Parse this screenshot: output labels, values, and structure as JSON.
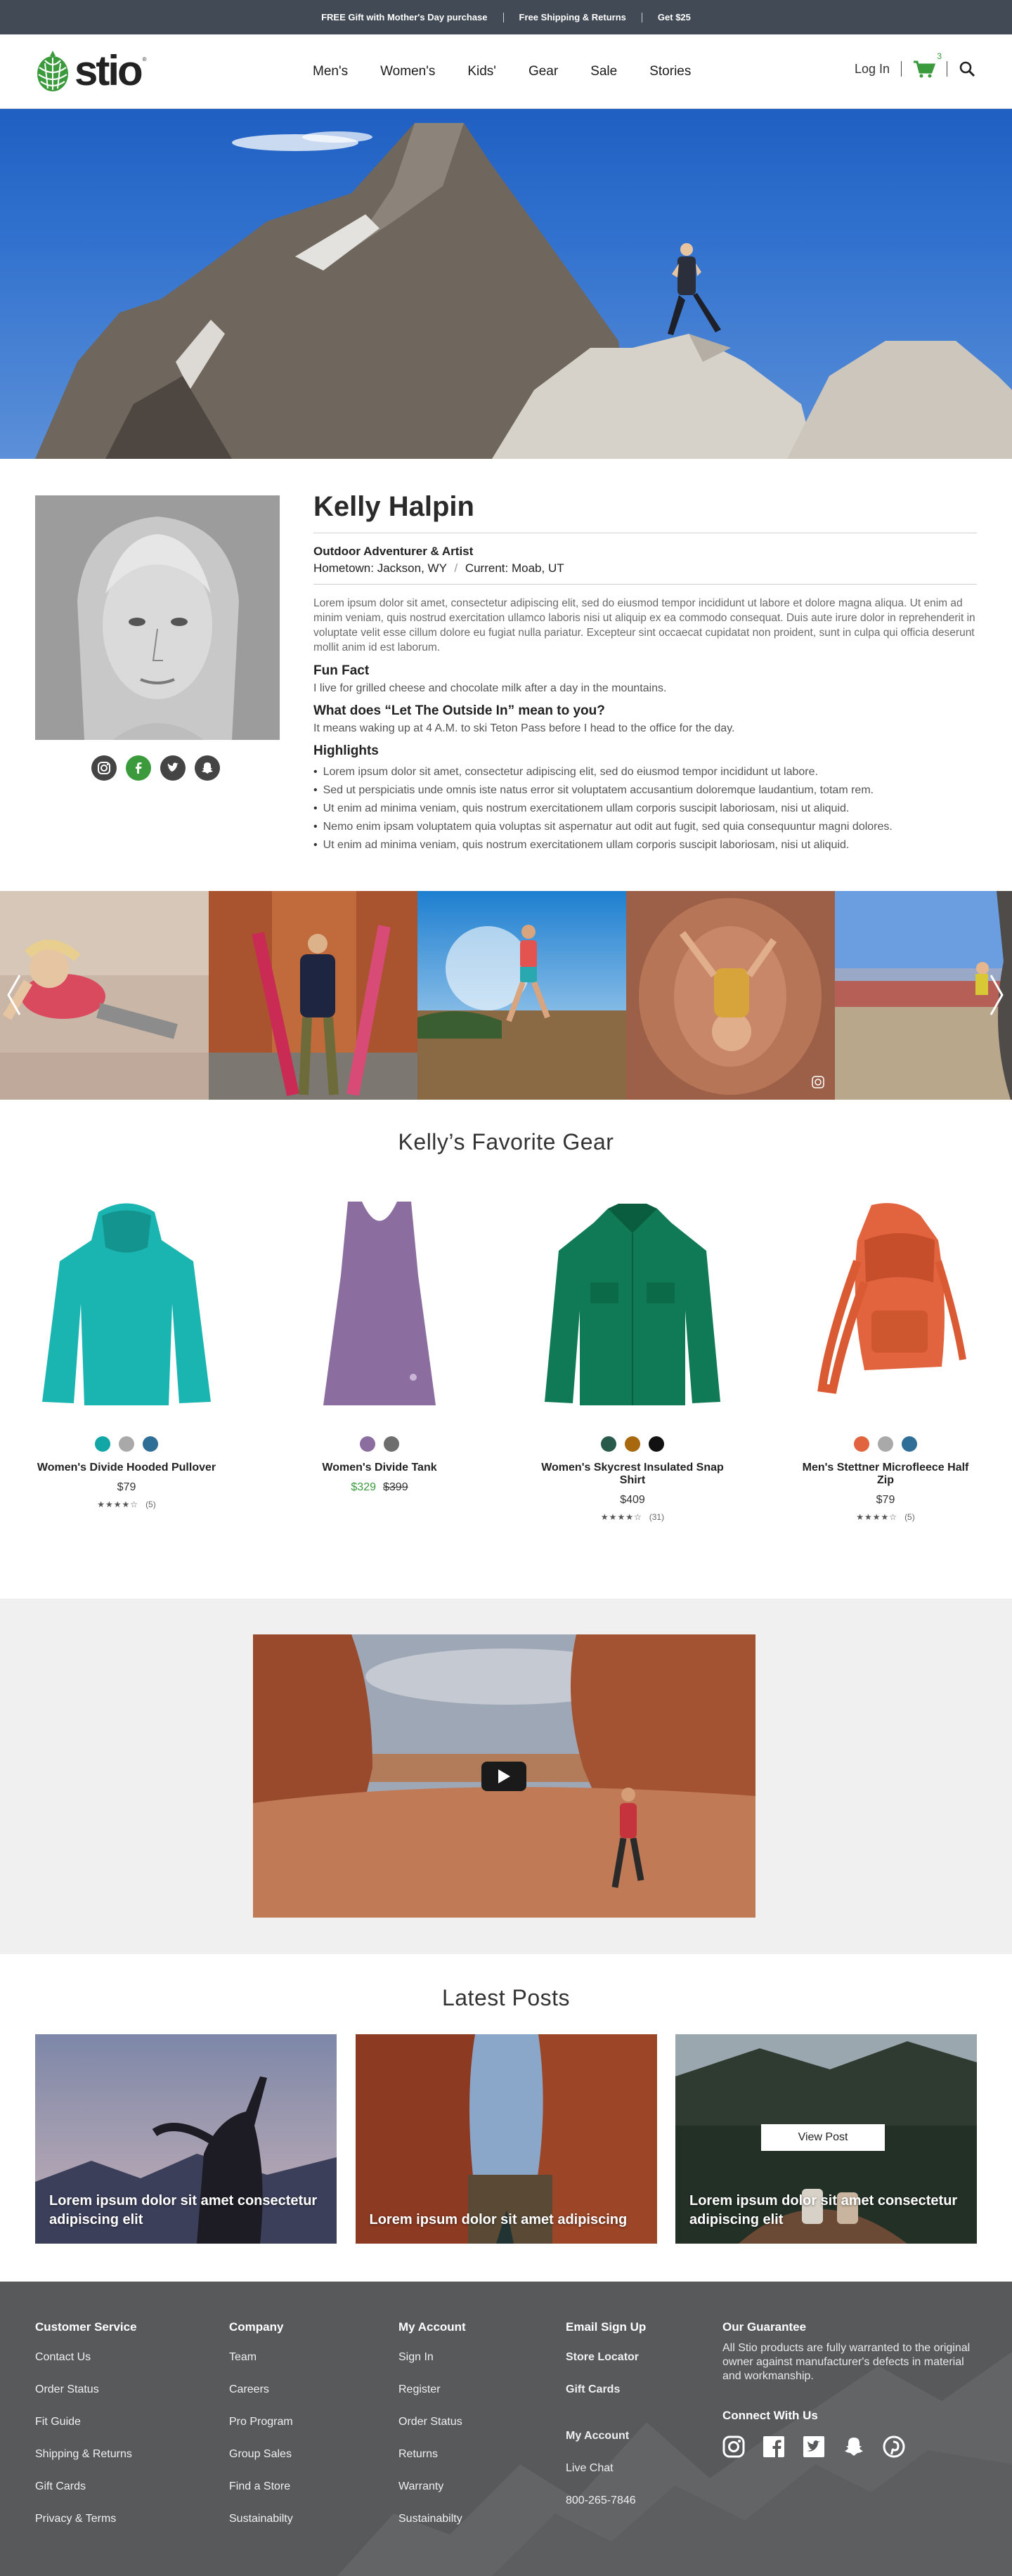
{
  "promo": {
    "items": [
      "FREE Gift with Mother's Day purchase",
      "Free Shipping & Returns",
      "Get $25"
    ]
  },
  "header": {
    "logo_text": "stio",
    "logo_tm": "®",
    "nav": [
      "Men's",
      "Women's",
      "Kids'",
      "Gear",
      "Sale",
      "Stories"
    ],
    "login": "Log In",
    "cart_count": "3",
    "icons": [
      "cart-icon",
      "search-icon"
    ]
  },
  "profile": {
    "name": "Kelly Halpin",
    "role": "Outdoor Adventurer & Artist",
    "hometown_label": "Hometown:",
    "hometown": "Jackson, WY",
    "current_label": "Current:",
    "current": "Moab, UT",
    "bio": "Lorem ipsum dolor sit amet, consectetur adipiscing elit, sed do eiusmod tempor incididunt ut labore et dolore magna aliqua. Ut enim ad minim veniam, quis nostrud exercitation ullamco laboris nisi ut aliquip ex ea commodo consequat. Duis aute irure dolor in reprehenderit in voluptate velit esse cillum dolore eu fugiat nulla pariatur. Excepteur sint occaecat cupidatat non proident, sunt in culpa qui officia deserunt mollit anim id est laborum.",
    "fun_fact_title": "Fun Fact",
    "fun_fact": "I live for grilled cheese and chocolate milk after a day in the mountains.",
    "outside_title": "What does “Let The Outside In” mean to you?",
    "outside_answer": "It means waking up at 4 A.M. to ski Teton Pass before I head to the office for the day.",
    "highlights_title": "Highlights",
    "highlights": [
      "Lorem ipsum dolor sit amet, consectetur adipiscing elit, sed do eiusmod tempor incididunt ut labore.",
      "Sed ut perspiciatis unde omnis iste natus error sit voluptatem accusantium doloremque laudantium, totam rem.",
      "Ut enim ad minima veniam, quis nostrum exercitationem ullam corporis suscipit laboriosam, nisi ut aliquid.",
      "Nemo enim ipsam voluptatem quia voluptas sit aspernatur aut odit aut fugit, sed quia consequuntur magni dolores.",
      "Ut enim ad minima veniam, quis nostrum exercitationem ullam corporis suscipit laboriosam, nisi ut aliquid."
    ],
    "social_icons": [
      "instagram-icon",
      "facebook-icon",
      "twitter-icon",
      "snapchat-icon"
    ]
  },
  "gear": {
    "title": "Kelly’s Favorite Gear",
    "products": [
      {
        "name": "Women's Divide Hooded Pullover",
        "price": "$79",
        "sale_price": "",
        "was_price": "",
        "rating": 4,
        "reviews": "(5)",
        "swatches": [
          "#12a6a6",
          "#a9a9a9",
          "#2f6f97"
        ]
      },
      {
        "name": "Women's Divide Tank",
        "price": "",
        "sale_price": "$329",
        "was_price": "$399",
        "rating": 4,
        "reviews": "",
        "swatches": [
          "#8b6d9f",
          "#6e6e6e"
        ]
      },
      {
        "name": "Women's Skycrest Insulated Snap Shirt",
        "price": "$409",
        "sale_price": "",
        "was_price": "",
        "rating": 4,
        "reviews": "(31)",
        "swatches": [
          "#285a4b",
          "#a8680d",
          "#111111"
        ]
      },
      {
        "name": "Men's Stettner Microfleece Half Zip",
        "price": "$79",
        "sale_price": "",
        "was_price": "",
        "rating": 4,
        "reviews": "(5)",
        "swatches": [
          "#e2643e",
          "#a9a9a9",
          "#2f6f97"
        ]
      }
    ]
  },
  "posts": {
    "title": "Latest Posts",
    "items": [
      {
        "caption": "Lorem ipsum dolor sit amet consectetur adipiscing elit"
      },
      {
        "caption": "Lorem ipsum dolor sit amet adipiscing"
      },
      {
        "caption": "Lorem ipsum dolor sit amet consectetur adipiscing elit"
      }
    ],
    "view_post": "View Post"
  },
  "footer": {
    "customer_service": {
      "title": "Customer Service",
      "links": [
        "Contact Us",
        "Order Status",
        "Fit Guide",
        "Shipping & Returns",
        "Gift Cards",
        "Privacy & Terms"
      ]
    },
    "company": {
      "title": "Company",
      "links": [
        "Team",
        "Careers",
        "Pro Program",
        "Group Sales",
        "Find a Store",
        "Sustainabilty"
      ]
    },
    "my_account": {
      "title": "My Account",
      "links": [
        "Sign In",
        "Register",
        "Order Status",
        "Returns",
        "Warranty",
        "Sustainabilty"
      ]
    },
    "col4": {
      "email_signup": "Email Sign Up",
      "store_locator": "Store Locator",
      "gift_cards": "Gift Cards",
      "my_account": "My Account",
      "live_chat": "Live Chat",
      "phone": "800-265-7846"
    },
    "guarantee": {
      "title": "Our Guarantee",
      "text": "All Stio products are fully warranted to the original owner against manufacturer's defects in material and workmanship."
    },
    "connect": {
      "title": "Connect With Us",
      "icons": [
        "instagram-icon",
        "facebook-icon",
        "twitter-icon",
        "snapchat-icon",
        "pinterest-icon"
      ]
    }
  },
  "colors": {
    "promo_bg": "#424a56",
    "accent_green": "#3a9a3c",
    "footer_bg": "#58595b",
    "video_bg": "#f0f0f0"
  }
}
